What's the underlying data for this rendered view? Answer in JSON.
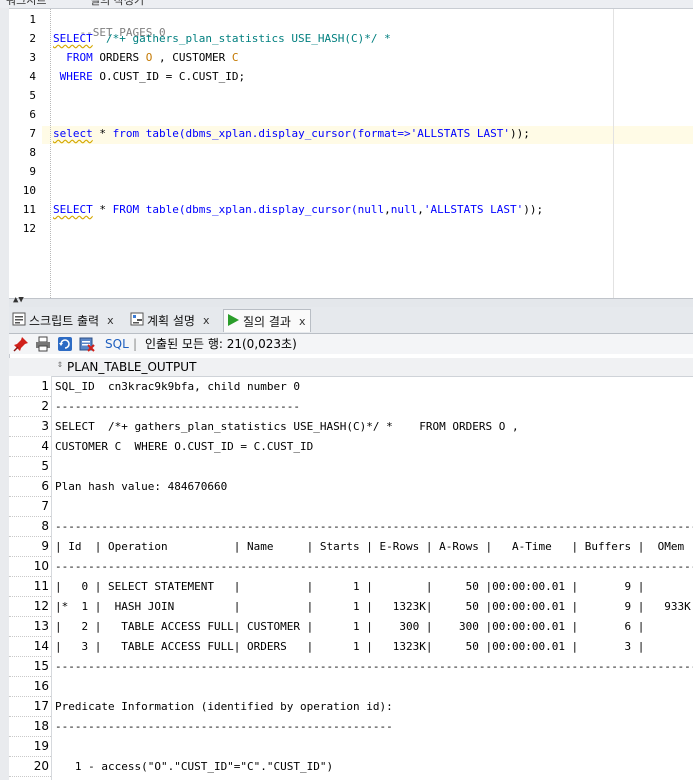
{
  "top_tabs": [
    "워크시트",
    "질의 작성기"
  ],
  "editor": {
    "line_numbers": [
      "1",
      "2",
      "3",
      "4",
      "5",
      "6",
      "7",
      "8",
      "9",
      "10",
      "11",
      "12"
    ],
    "lines": {
      "l1": "--SET PAGES 0",
      "l2_kw": "SELECT",
      "l2_hint": "  /*+ gathers_plan_statistics USE_HASH(C)*/ *",
      "l3_kw": "  FROM",
      "l3_a": " ORDERS ",
      "l3_o": "O",
      "l3_b": " , CUSTOMER ",
      "l3_c": "C",
      "l4_kw": " WHERE",
      "l4_rest": " O.CUST_ID = C.CUST_ID;",
      "l7_a": "select",
      "l7_b": " * ",
      "l7_c": "from",
      "l7_d": " table(dbms_xplan.display_cursor(",
      "l7_e": "format",
      "l7_f": "=>",
      "l7_g": "'ALLSTATS LAST'",
      "l7_h": "));",
      "l11_a": "SELECT",
      "l11_b": " * ",
      "l11_c": "FROM",
      "l11_d": " table(dbms_xplan.display_cursor(",
      "l11_e": "null",
      "l11_f": ",",
      "l11_g": "null",
      "l11_h": ",",
      "l11_i": "'ALLSTATS LAST'",
      "l11_j": "));"
    }
  },
  "result_tabs": [
    {
      "label": "스크립트 출력",
      "close": "x"
    },
    {
      "label": "계획 설명",
      "close": "x"
    },
    {
      "label": "질의 결과",
      "close": "x"
    }
  ],
  "toolbar": {
    "sql_label": "SQL",
    "separator": "|",
    "status": "인출된 모든 행: 21(0,023초)"
  },
  "grid": {
    "column": "PLAN_TABLE_OUTPUT",
    "rows": [
      {
        "n": "1",
        "text": "SQL_ID  cn3krac9k9bfa, child number 0"
      },
      {
        "n": "2",
        "text": "-------------------------------------"
      },
      {
        "n": "3",
        "text": "SELECT  /*+ gathers_plan_statistics USE_HASH(C)*/ *    FROM ORDERS O ,"
      },
      {
        "n": "4",
        "text": "CUSTOMER C  WHERE O.CUST_ID = C.CUST_ID"
      },
      {
        "n": "5",
        "text": ""
      },
      {
        "n": "6",
        "text": "Plan hash value: 484670660"
      },
      {
        "n": "7",
        "text": ""
      },
      {
        "n": "8",
        "text": "----------------------------------------------------------------------------------------------------"
      },
      {
        "n": "9",
        "text": "| Id  | Operation          | Name     | Starts | E-Rows | A-Rows |   A-Time   | Buffers |  OMem |"
      },
      {
        "n": "10",
        "text": "----------------------------------------------------------------------------------------------------"
      },
      {
        "n": "11",
        "text": "|   0 | SELECT STATEMENT   |          |      1 |        |     50 |00:00:00.01 |       9 |       |"
      },
      {
        "n": "12",
        "text": "|*  1 |  HASH JOIN         |          |      1 |   1323K|     50 |00:00:00.01 |       9 |   933K|"
      },
      {
        "n": "13",
        "text": "|   2 |   TABLE ACCESS FULL| CUSTOMER |      1 |    300 |    300 |00:00:00.01 |       6 |       |"
      },
      {
        "n": "14",
        "text": "|   3 |   TABLE ACCESS FULL| ORDERS   |      1 |   1323K|     50 |00:00:00.01 |       3 |       |"
      },
      {
        "n": "15",
        "text": "----------------------------------------------------------------------------------------------------"
      },
      {
        "n": "16",
        "text": ""
      },
      {
        "n": "17",
        "text": "Predicate Information (identified by operation id):"
      },
      {
        "n": "18",
        "text": "---------------------------------------------------"
      },
      {
        "n": "19",
        "text": ""
      },
      {
        "n": "20",
        "text": "   1 - access(\"O\".\"CUST_ID\"=\"C\".\"CUST_ID\")"
      }
    ]
  },
  "colors": {
    "keyword": "#0000ff",
    "comment": "#7f7f7f",
    "hint": "#007f7f",
    "alias": "#c47800",
    "pin": "#d0201a",
    "run": "#2a9d2a"
  }
}
